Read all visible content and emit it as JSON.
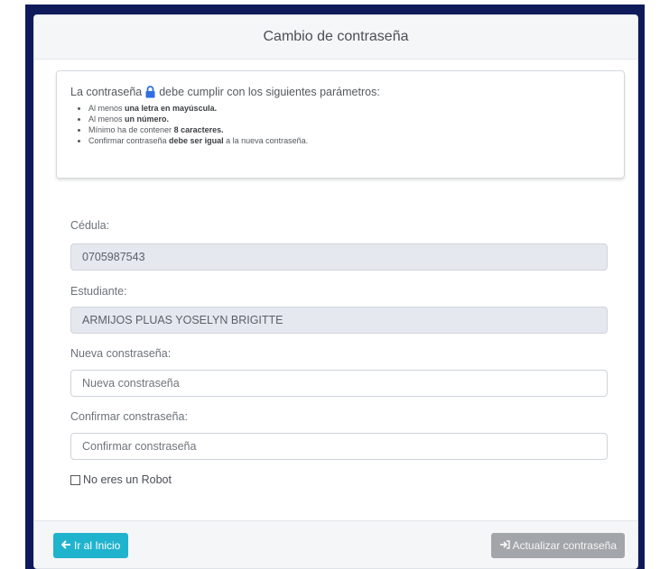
{
  "header": {
    "title": "Cambio de contraseña"
  },
  "info": {
    "intro_before": "La contraseña",
    "intro_after": "debe cumplir con los siguientes parámetros:",
    "lock_icon": "lock-icon",
    "rules": [
      {
        "pre": "Al menos ",
        "bold": "una letra en mayúscula.",
        "post": ""
      },
      {
        "pre": "Al menos ",
        "bold": "un número.",
        "post": ""
      },
      {
        "pre": "Mínimo ha de contener ",
        "bold": "8 caracteres.",
        "post": ""
      },
      {
        "pre": "Confirmar contraseña ",
        "bold": "debe ser igual",
        "post": " a la nueva contraseña."
      }
    ]
  },
  "form": {
    "cedula_label": "Cédula:",
    "cedula_value": "0705987543",
    "estudiante_label": "Estudiante:",
    "estudiante_value": "ARMIJOS PLUAS YOSELYN BRIGITTE",
    "nueva_label": "Nueva constraseña:",
    "nueva_placeholder": "Nueva constraseña",
    "confirmar_label": "Confirmar constraseña:",
    "confirmar_placeholder": "Confirmar constraseña",
    "robot_label": "No eres un Robot"
  },
  "footer": {
    "home_label": "Ir al Inicio",
    "home_icon": "arrow-left-icon",
    "update_label": "Actualizar contraseña",
    "update_icon": "sign-in-icon"
  },
  "colors": {
    "frame": "#0f1a5a",
    "home_button": "#20b3cd",
    "update_button": "#a2a6ab",
    "lock_icon": "#2f6fe0",
    "readonly_field": "#e6e8ef"
  }
}
